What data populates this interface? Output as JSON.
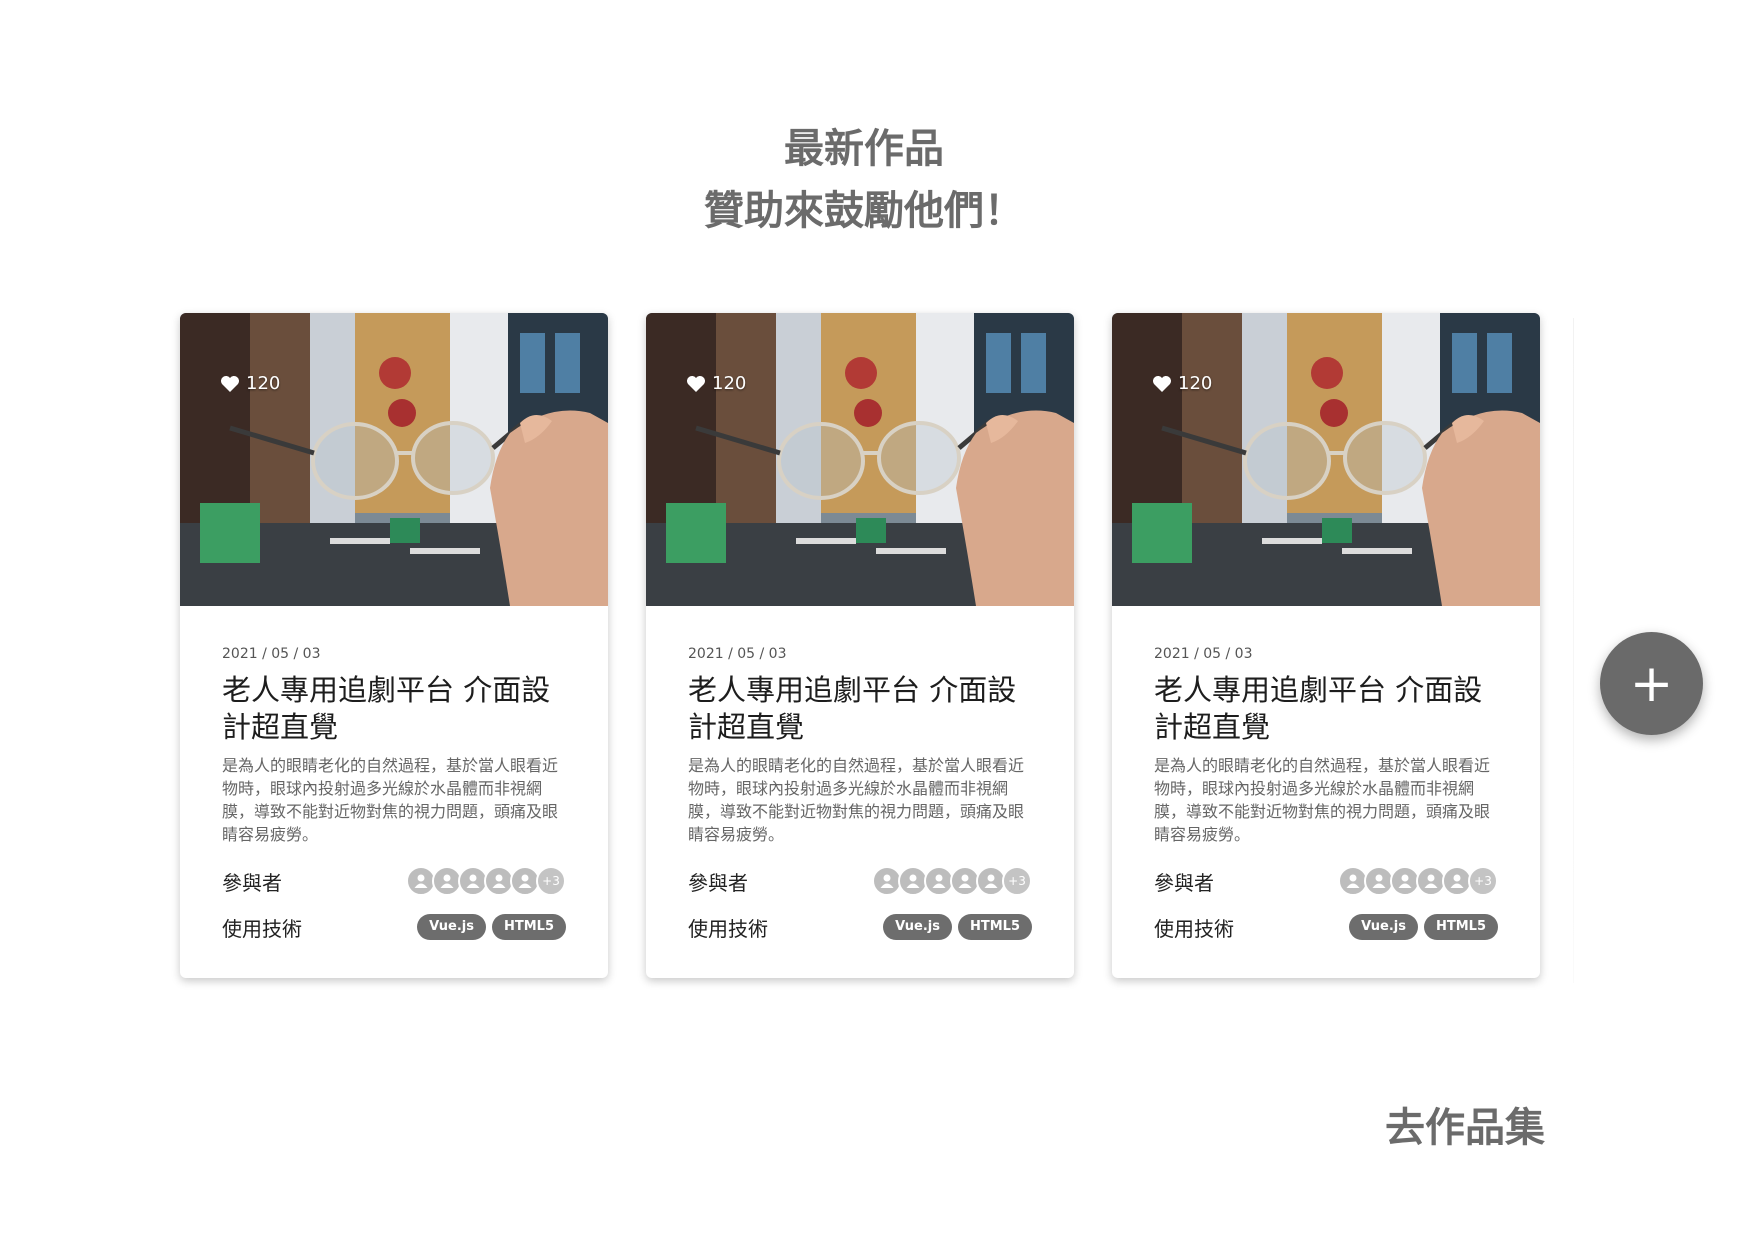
{
  "section": {
    "title_line1": "最新作品",
    "title_line2": "贊助來鼓勵他們！"
  },
  "cards": [
    {
      "likes": "120",
      "date": "2021 / 05 / 03",
      "title": "老人專用追劇平台 介面設計超直覺",
      "description": "是為人的眼睛老化的自然過程，基於當人眼看近物時，眼球內投射過多光線於水晶體而非視網膜，導致不能對近物對焦的視力問題，頭痛及眼睛容易疲勞。",
      "participants_label": "參與者",
      "participants_more": "+3",
      "tech_label": "使用技術",
      "tags": [
        "Vue.js",
        "HTML5"
      ]
    },
    {
      "likes": "120",
      "date": "2021 / 05 / 03",
      "title": "老人專用追劇平台 介面設計超直覺",
      "description": "是為人的眼睛老化的自然過程，基於當人眼看近物時，眼球內投射過多光線於水晶體而非視網膜，導致不能對近物對焦的視力問題，頭痛及眼睛容易疲勞。",
      "participants_label": "參與者",
      "participants_more": "+3",
      "tech_label": "使用技術",
      "tags": [
        "Vue.js",
        "HTML5"
      ]
    },
    {
      "likes": "120",
      "date": "2021 / 05 / 03",
      "title": "老人專用追劇平台 介面設計超直覺",
      "description": "是為人的眼睛老化的自然過程，基於當人眼看近物時，眼球內投射過多光線於水晶體而非視網膜，導致不能對近物對焦的視力問題，頭痛及眼睛容易疲勞。",
      "participants_label": "參與者",
      "participants_more": "+3",
      "tech_label": "使用技術",
      "tags": [
        "Vue.js",
        "HTML5"
      ]
    }
  ],
  "fab": {
    "icon": "plus-icon",
    "label": "+"
  },
  "footer": {
    "gallery_link": "去作品集"
  },
  "colors": {
    "heading": "#6b6b6b",
    "tag_bg": "#6d6d6d",
    "fab_bg": "#6a6a6a"
  }
}
